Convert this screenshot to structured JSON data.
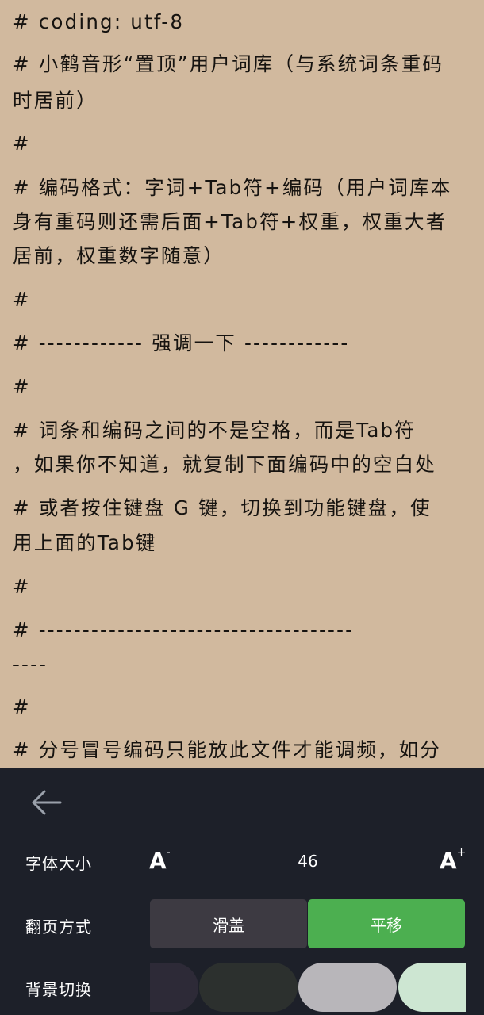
{
  "document": {
    "lines": [
      "# coding: utf-8",
      "# 小鹤音形“置顶”用户词库（与系统词条重码",
      "时居前）",
      "#",
      "# 编码格式：字词+Tab符+编码（用户词库本",
      "身有重码则还需后面+Tab符+权重，权重大者",
      "居前，权重数字随意）",
      "#",
      "# ------------ 强调一下 ------------",
      "#",
      "#  词条和编码之间的不是空格，而是Tab符",
      "，如果你不知道，就复制下面编码中的空白处",
      "#  或者按住键盘 G 键，切换到功能键盘，使",
      "用上面的Tab键",
      "#",
      "# ------------------------------------",
      "----",
      "#",
      "# 分号冒号编码只能放此文件才能调频，如分"
    ]
  },
  "settings": {
    "back_icon": "arrow-left-icon",
    "font_size": {
      "label": "字体大小",
      "decrease_base": "A",
      "decrease_mark": "-",
      "increase_base": "A",
      "increase_mark": "+",
      "value": "46"
    },
    "page_turn": {
      "label": "翻页方式",
      "options": [
        "滑盖",
        "平移"
      ],
      "selected": "平移"
    },
    "background": {
      "label": "背景切换",
      "swatches": [
        "#2d2a37",
        "#2c302e",
        "#b8b6ba",
        "#cde6d2"
      ]
    }
  },
  "colors": {
    "page_background": "#d1b99e",
    "panel_background": "#1d2029",
    "accent_green": "#4caf50",
    "unselected_segment": "#3d3a42"
  }
}
